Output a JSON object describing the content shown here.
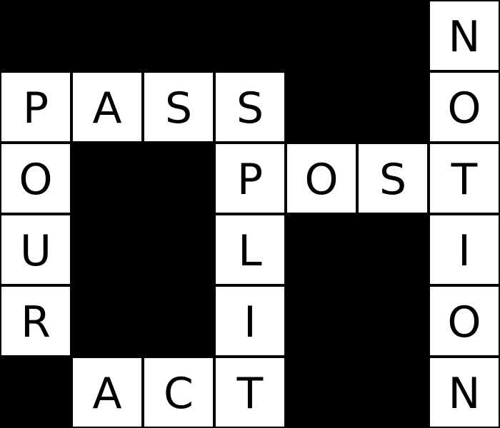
{
  "puzzle": {
    "rows": 6,
    "cols": 7,
    "grid": [
      [
        "",
        "",
        "",
        "",
        "",
        "",
        "N"
      ],
      [
        "P",
        "A",
        "S",
        "S",
        "",
        "",
        "O"
      ],
      [
        "O",
        "",
        "",
        "P",
        "O",
        "S",
        "T"
      ],
      [
        "U",
        "",
        "",
        "L",
        "",
        "",
        "I"
      ],
      [
        "R",
        "",
        "",
        "I",
        "",
        "",
        "O"
      ],
      [
        "",
        "A",
        "C",
        "T",
        "",
        "",
        "N"
      ]
    ],
    "words": [
      "PASS",
      "POST",
      "ACT",
      "POUR",
      "SPLIT",
      "NOTION"
    ]
  },
  "colors": {
    "block": "#000000",
    "cell": "#ffffff",
    "letter": "#000000"
  }
}
